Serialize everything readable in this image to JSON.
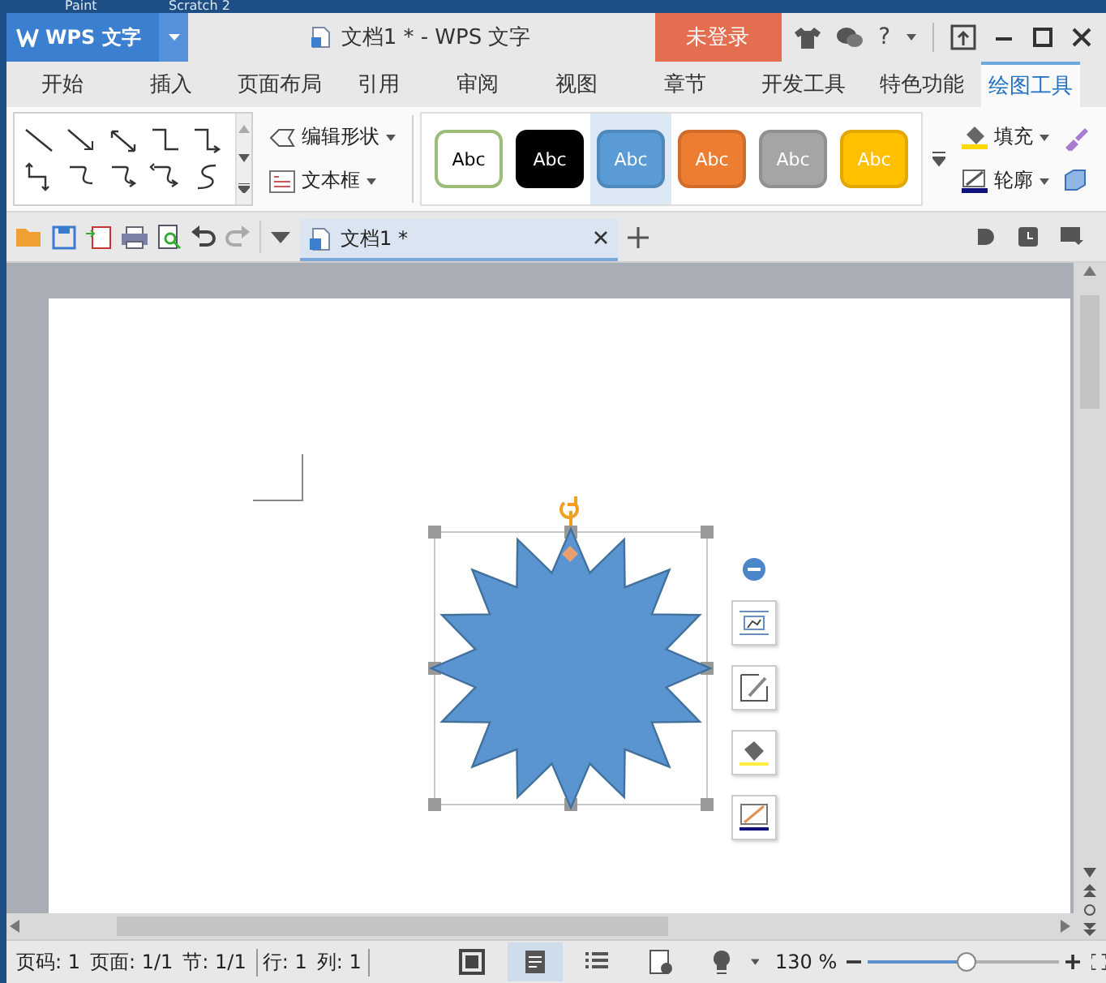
{
  "desktop_taskbar": {
    "items": [
      "Paint",
      "Scratch 2"
    ]
  },
  "title_bar": {
    "app_menu": "WPS 文字",
    "title": "文档1 * - WPS 文字",
    "login_button": "未登录",
    "help": "?"
  },
  "ribbon_tabs": [
    {
      "label": "开始",
      "selected": false
    },
    {
      "label": "插入",
      "selected": false
    },
    {
      "label": "页面布局",
      "selected": false
    },
    {
      "label": "引用",
      "selected": false
    },
    {
      "label": "审阅",
      "selected": false
    },
    {
      "label": "视图",
      "selected": false
    },
    {
      "label": "章节",
      "selected": false
    },
    {
      "label": "开发工具",
      "selected": false
    },
    {
      "label": "特色功能",
      "selected": false
    },
    {
      "label": "绘图工具",
      "selected": true
    }
  ],
  "ribbon": {
    "edit_shape": "编辑形状",
    "text_box": "文本框",
    "style_presets": [
      {
        "label": "Abc",
        "color": "#ffffff",
        "selected": false
      },
      {
        "label": "Abc",
        "color": "#000000",
        "selected": false
      },
      {
        "label": "Abc",
        "color": "#5b9bd5",
        "selected": true
      },
      {
        "label": "Abc",
        "color": "#ed7d31",
        "selected": false
      },
      {
        "label": "Abc",
        "color": "#a5a5a5",
        "selected": false
      },
      {
        "label": "Abc",
        "color": "#ffc000",
        "selected": false
      }
    ],
    "fill": "填充",
    "outline": "轮廓"
  },
  "doc_tabs": [
    {
      "label": "文档1 *",
      "selected": true
    }
  ],
  "status_bar": {
    "fields": [
      "页码: 1",
      "页面: 1/1",
      "节: 1/1",
      "行: 1",
      "列: 1"
    ],
    "views": [
      {
        "kind": "fullscreen",
        "selected": false
      },
      {
        "kind": "page",
        "selected": true
      },
      {
        "kind": "outline",
        "selected": false
      },
      {
        "kind": "web",
        "selected": false
      },
      {
        "kind": "reading",
        "selected": false
      }
    ],
    "zoom": "130 %",
    "zoom_slider": {
      "level": 0.52
    }
  }
}
